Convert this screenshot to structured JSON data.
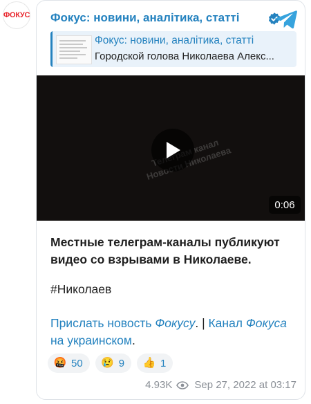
{
  "avatar": {
    "text": "ФОКУС"
  },
  "post": {
    "channel_title": "Фокус: новини, аналітика, статті",
    "reply": {
      "title": "Фокус: новини, аналітика, статті",
      "text": "Городской голова Николаева Алекс..."
    },
    "video": {
      "duration": "0:06",
      "watermark_line1": "Телеграм канал",
      "watermark_line2": "Новости Николаева"
    },
    "paragraph1": "Местные телеграм-каналы публикуют видео со взрывами в Николаеве.",
    "hashtag": "#Николаев",
    "links": {
      "part1": "Прислать новость ",
      "part2": "Фокусу",
      "sep": ". | ",
      "part3": "Канал ",
      "part4": "Фокуса",
      "part5": " на украинском",
      "end": "."
    },
    "reactions": [
      {
        "emoji": "🤬",
        "count": "50"
      },
      {
        "emoji": "😢",
        "count": "9"
      },
      {
        "emoji": "👍",
        "count": "1"
      }
    ],
    "views": "4.93K",
    "date": "Sep 27, 2022 at 03:17"
  },
  "colors": {
    "link": "#2482bf",
    "brand_red": "#e8262d",
    "video_bg": "#120f0e"
  }
}
